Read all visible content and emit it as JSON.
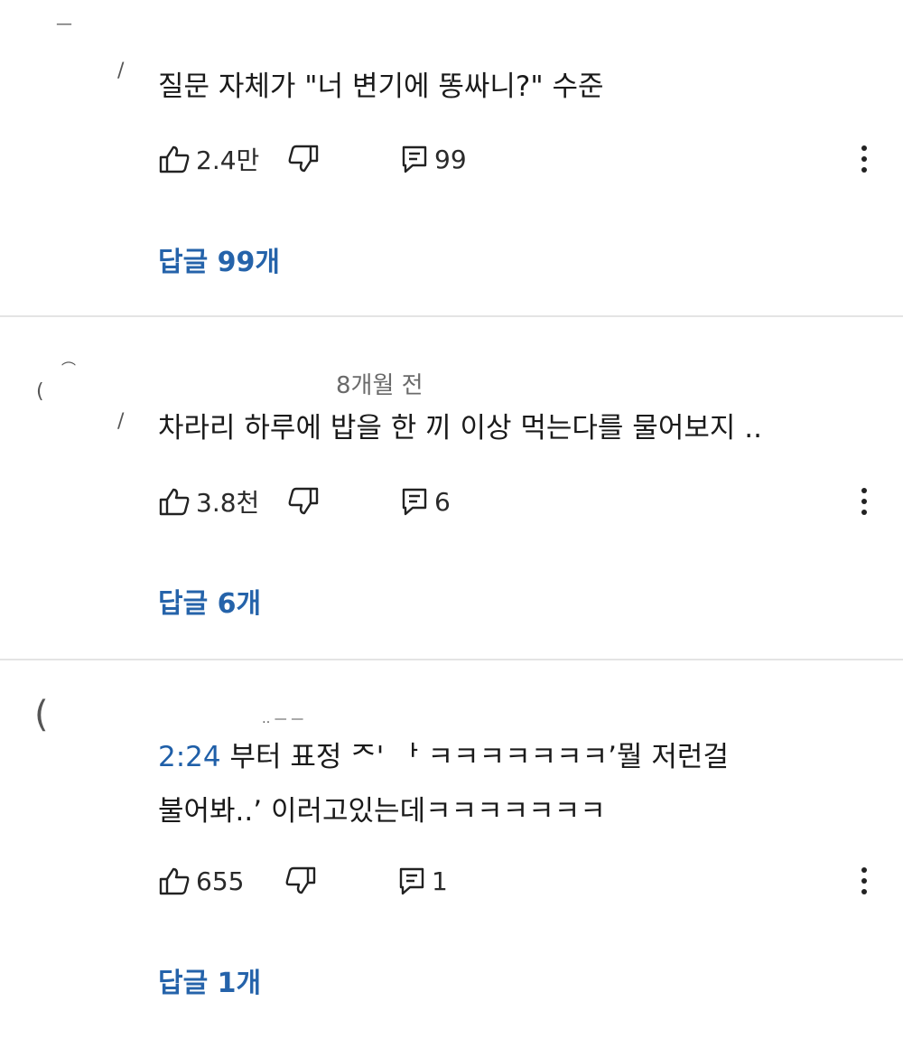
{
  "comments": [
    {
      "meta": "",
      "text_lines": [
        "질문 자체가 \"너 변기에 똥싸니?\" 수준"
      ],
      "likes": "2.4만",
      "reply_count": "99",
      "replies_label": "답글 99개"
    },
    {
      "meta": "8개월 전",
      "text_lines": [
        "차라리 하루에 밥을 한 끼 이상 먹는다를 물어보지 .."
      ],
      "likes": "3.8천",
      "reply_count": "6",
      "replies_label": "답글 6개"
    },
    {
      "meta": "",
      "timestamp_link": "2:24",
      "text_lines": [
        " 부터 표정 ᄌ' ᅡ ㅋㅋㅋㅋㅋㅋㅋ’뭘 저런걸",
        "불어봐..’ 이러고있는데ㅋㅋㅋㅋㅋㅋㅋ"
      ],
      "likes": "655",
      "reply_count": "1",
      "replies_label": "답글 1개"
    }
  ],
  "icons": {
    "like": "thumbs-up-icon",
    "dislike": "thumbs-down-icon",
    "reply": "comment-icon",
    "more": "more-vert-icon"
  },
  "colors": {
    "link_blue": "#2563aa",
    "timestamp_blue": "#1f5fa8",
    "divider": "#e4e4e4"
  }
}
